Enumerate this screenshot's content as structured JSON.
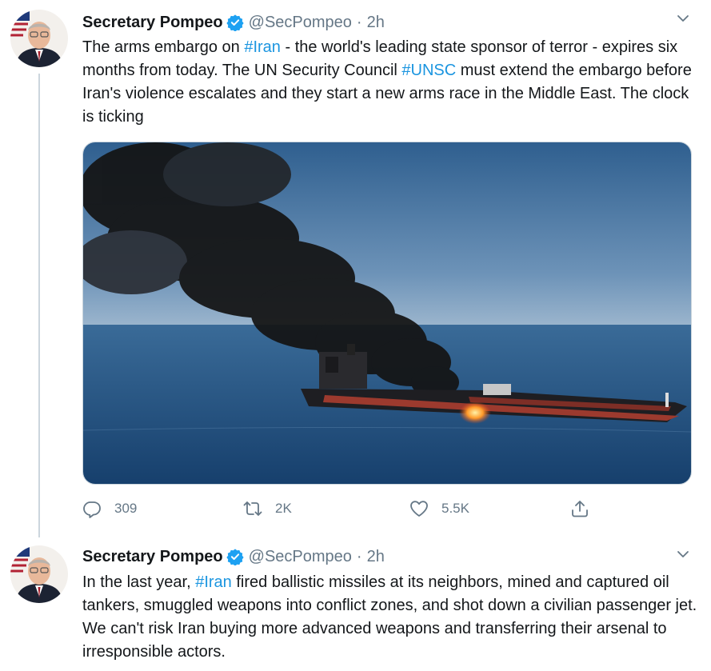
{
  "tweets": [
    {
      "author_name": "Secretary Pompeo",
      "handle": "@SecPompeo",
      "separator": "·",
      "time": "2h",
      "text_parts": [
        "The arms embargo on ",
        "#Iran",
        " - the world's leading state sponsor of terror - expires six months from today. The UN Security Council ",
        "#UNSC",
        " must extend the embargo before Iran's violence escalates and they start a new arms race in the Middle East. The clock is ticking"
      ],
      "stats": {
        "replies": "309",
        "retweets": "2K",
        "likes": "5.5K"
      },
      "media_icon": "burning-oil-tanker-photo"
    },
    {
      "author_name": "Secretary Pompeo",
      "handle": "@SecPompeo",
      "separator": "·",
      "time": "2h",
      "text_parts": [
        "In the last year, ",
        "#Iran",
        " fired ballistic missiles at its neighbors, mined and captured oil tankers, smuggled weapons into conflict zones, and shot down a civilian passenger jet. We can't risk Iran buying more advanced weapons and transferring their arsenal to irresponsible actors."
      ]
    }
  ],
  "colors": {
    "link": "#1b95e0",
    "secondary": "#657786",
    "verified": "#1da1f2",
    "thread_line": "#ccd6dd"
  },
  "icons": [
    "verified-badge-icon",
    "chevron-down-icon",
    "reply-icon",
    "retweet-icon",
    "like-icon",
    "share-icon"
  ]
}
